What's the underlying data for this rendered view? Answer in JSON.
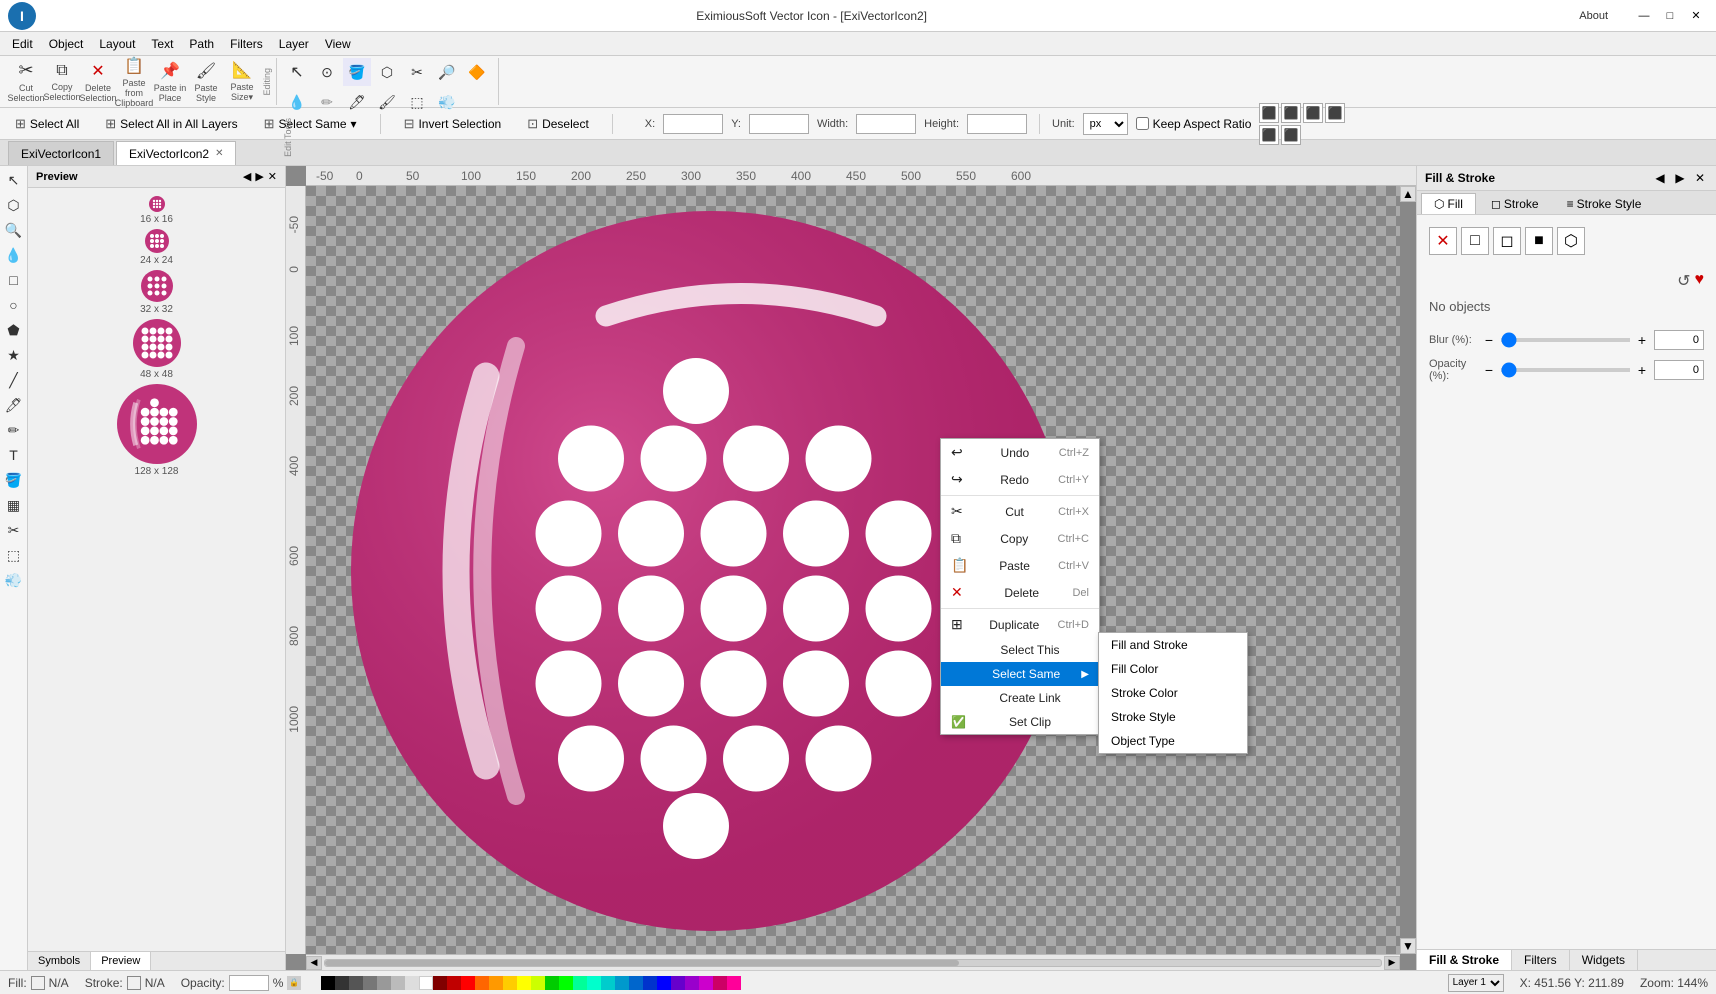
{
  "app": {
    "title": "EximiousSoft Vector Icon - [ExiVectorIcon2]",
    "about_label": "About"
  },
  "window_controls": {
    "minimize": "—",
    "maximize": "□",
    "close": "✕"
  },
  "menu": {
    "items": [
      "Edit",
      "Object",
      "Layout",
      "Text",
      "Path",
      "Filters",
      "Layer",
      "View"
    ]
  },
  "toolbar": {
    "groups": [
      {
        "name": "clipboard",
        "buttons": [
          {
            "id": "cut",
            "icon": "✂",
            "label": "Cut\nSelection"
          },
          {
            "id": "copy",
            "icon": "⧉",
            "label": "Copy\nSelection"
          },
          {
            "id": "delete",
            "icon": "✕",
            "label": "Delete\nSelection"
          },
          {
            "id": "paste-from-clipboard",
            "icon": "📋",
            "label": "Paste from\nClipboard"
          },
          {
            "id": "paste-in-place",
            "icon": "📌",
            "label": "Paste in\nPlace"
          },
          {
            "id": "paste-style",
            "icon": "🖌",
            "label": "Paste\nStyle"
          },
          {
            "id": "paste-size",
            "icon": "📐",
            "label": "Paste\nSize▾"
          }
        ],
        "label": "Editing"
      },
      {
        "name": "edit-tools",
        "buttons": [
          {
            "id": "select-tool",
            "icon": "↖",
            "label": ""
          },
          {
            "id": "zoom-tool",
            "icon": "🔍",
            "label": ""
          },
          {
            "id": "fill-tool",
            "icon": "🪣",
            "label": ""
          },
          {
            "id": "node-tool",
            "icon": "⬡",
            "label": ""
          },
          {
            "id": "knife-tool",
            "icon": "✂",
            "label": ""
          },
          {
            "id": "magnify-tool",
            "icon": "🔎",
            "label": ""
          },
          {
            "id": "color-tool1",
            "icon": "🔶",
            "label": ""
          },
          {
            "id": "color-tool2",
            "icon": "💧",
            "label": ""
          },
          {
            "id": "pencil-tool",
            "icon": "✏",
            "label": ""
          },
          {
            "id": "pen-tool",
            "icon": "🖊",
            "label": ""
          },
          {
            "id": "brush-tool",
            "icon": "🖌",
            "label": ""
          },
          {
            "id": "eraser-tool",
            "icon": "⬚",
            "label": ""
          },
          {
            "id": "spray-tool",
            "icon": "💨",
            "label": ""
          }
        ],
        "label": "Edit Tools"
      }
    ]
  },
  "select_toolbar": {
    "select_all_label": "Select All",
    "select_all_in_layers_label": "Select All in All Layers",
    "select_same_label": "Select Same",
    "invert_selection_label": "Invert Selection",
    "deselect_label": "Deselect",
    "x_label": "X:",
    "y_label": "Y:",
    "width_label": "Width:",
    "height_label": "Height:",
    "unit_label": "px",
    "keep_aspect_label": "Keep Aspect Ratio"
  },
  "tabs": {
    "items": [
      {
        "id": "tab1",
        "label": "ExiVectorIcon1",
        "active": false
      },
      {
        "id": "tab2",
        "label": "ExiVectorIcon2",
        "active": true
      }
    ]
  },
  "preview_panel": {
    "title": "Preview",
    "sizes": [
      {
        "label": "16 x 16",
        "size": 16
      },
      {
        "label": "24 x 24",
        "size": 24
      },
      {
        "label": "32 x 32",
        "size": 32
      },
      {
        "label": "48 x 48",
        "size": 48
      },
      {
        "label": "128 x 128",
        "size": 80
      }
    ],
    "tabs": [
      "Symbols",
      "Preview"
    ]
  },
  "context_menu": {
    "items": [
      {
        "id": "undo",
        "label": "Undo",
        "shortcut": "Ctrl+Z",
        "icon": "↩"
      },
      {
        "id": "redo",
        "label": "Redo",
        "shortcut": "Ctrl+Y",
        "icon": "↪"
      },
      {
        "id": "cut",
        "label": "Cut",
        "shortcut": "Ctrl+X",
        "icon": "✂"
      },
      {
        "id": "copy",
        "label": "Copy",
        "shortcut": "Ctrl+C",
        "icon": "⧉"
      },
      {
        "id": "paste",
        "label": "Paste",
        "shortcut": "Ctrl+V",
        "icon": "📋"
      },
      {
        "id": "delete",
        "label": "Delete",
        "shortcut": "Del",
        "icon": "✕"
      },
      {
        "id": "duplicate",
        "label": "Duplicate",
        "shortcut": "Ctrl+D",
        "icon": "⊞"
      },
      {
        "id": "select-this",
        "label": "Select This",
        "shortcut": "",
        "icon": ""
      },
      {
        "id": "select-same",
        "label": "Select Same",
        "shortcut": "",
        "icon": "",
        "has_submenu": true,
        "highlighted": true
      },
      {
        "id": "create-link",
        "label": "Create Link",
        "shortcut": "",
        "icon": ""
      },
      {
        "id": "set-clip",
        "label": "Set Clip",
        "shortcut": "",
        "icon": "✅"
      }
    ]
  },
  "submenu": {
    "items": [
      {
        "id": "fill-and-stroke",
        "label": "Fill and Stroke"
      },
      {
        "id": "fill-color",
        "label": "Fill Color"
      },
      {
        "id": "stroke-color",
        "label": "Stroke Color"
      },
      {
        "id": "stroke-style",
        "label": "Stroke Style"
      },
      {
        "id": "object-type",
        "label": "Object Type"
      }
    ]
  },
  "fill_stroke_panel": {
    "title": "Fill & Stroke",
    "tabs": [
      "Fill",
      "Stroke",
      "Stroke Style"
    ],
    "no_objects_label": "No objects",
    "blur_label": "Blur (%):",
    "blur_value": "0",
    "opacity_label": "Opacity (%):",
    "opacity_value": "0",
    "type_buttons": [
      "✕",
      "□",
      "◻",
      "■",
      "⬡"
    ],
    "bottom_tabs": [
      "Fill & Stroke",
      "Filters",
      "Widgets"
    ],
    "refresh_icon": "↺",
    "heart_icon": "♥"
  },
  "status_bar": {
    "fill_label": "Fill:",
    "fill_value": "N/A",
    "stroke_label": "Stroke:",
    "stroke_value": "N/A",
    "opacity_label": "Opacity:",
    "layer_label": "Layer 1",
    "coordinates": "X: 451.56 Y: 211.89",
    "zoom": "Zoom: 144%"
  },
  "ruler": {
    "marks": [
      "-50",
      "0",
      "50",
      "100",
      "150",
      "200",
      "250",
      "300",
      "350",
      "400",
      "450",
      "500",
      "550",
      "600"
    ]
  }
}
